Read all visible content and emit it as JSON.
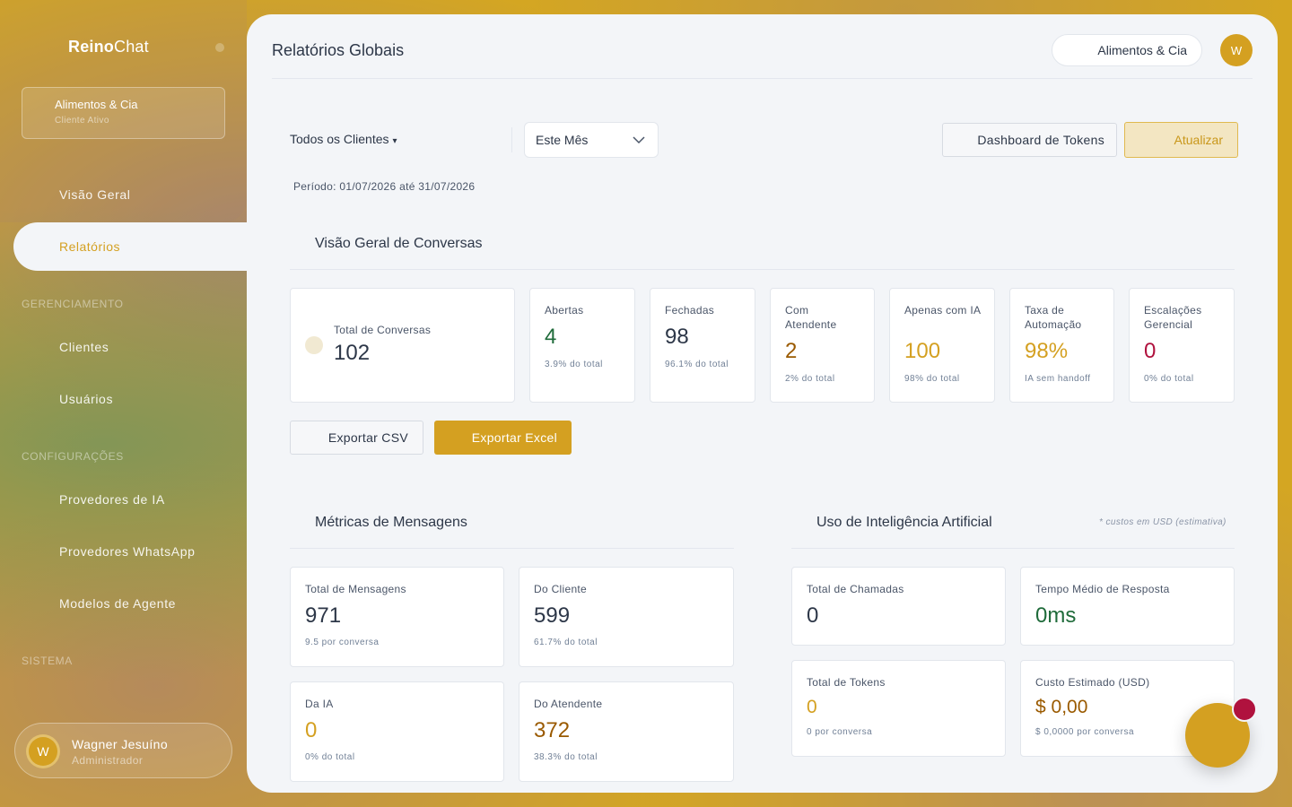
{
  "sidebar": {
    "brand_bold": "Reino",
    "brand_light": "Chat",
    "client_name": "Alimentos & Cia",
    "client_status": "Cliente Ativo",
    "nav": {
      "overview": "Visão Geral",
      "reports": "Relatórios"
    },
    "sections": {
      "management": "GERENCIAMENTO",
      "settings": "CONFIGURAÇÕES",
      "system": "SISTEMA"
    },
    "management_items": {
      "clients": "Clientes",
      "users": "Usuários"
    },
    "settings_items": {
      "ai_providers": "Provedores de IA",
      "whatsapp_providers": "Provedores WhatsApp",
      "agent_models": "Modelos de Agente"
    },
    "user": {
      "initial": "W",
      "name": "Wagner Jesuíno",
      "role": "Administrador"
    }
  },
  "header": {
    "title": "Relatórios Globais",
    "client_selector": "Alimentos & Cia",
    "avatar_initial": "W"
  },
  "filters": {
    "client_filter": "Todos os Clientes",
    "period_select": "Este Mês",
    "tokens_button": "Dashboard de Tokens",
    "update_button": "Atualizar",
    "period_text": "Período: 01/07/2026 até 31/07/2026"
  },
  "conversations": {
    "title": "Visão Geral de Conversas",
    "total": {
      "label": "Total de Conversas",
      "value": "102"
    },
    "cards": [
      {
        "label": "Abertas",
        "value": "4",
        "sub": "3.9% do total"
      },
      {
        "label": "Fechadas",
        "value": "98",
        "sub": "96.1% do total"
      },
      {
        "label": "Com Atendente",
        "value": "2",
        "sub": "2% do total"
      },
      {
        "label": "Apenas com IA",
        "value": "100",
        "sub": "98% do total"
      },
      {
        "label": "Taxa de Automação",
        "value": "98%",
        "sub": "IA sem handoff"
      },
      {
        "label": "Escalações Gerencial",
        "value": "0",
        "sub": "0% do total"
      }
    ],
    "export_csv": "Exportar CSV",
    "export_excel": "Exportar Excel"
  },
  "messages": {
    "title": "Métricas de Mensagens",
    "cards": [
      {
        "label": "Total de Mensagens",
        "value": "971",
        "sub": "9.5 por conversa"
      },
      {
        "label": "Do Cliente",
        "value": "599",
        "sub": "61.7% do total"
      },
      {
        "label": "Da IA",
        "value": "0",
        "sub": "0% do total"
      },
      {
        "label": "Do Atendente",
        "value": "372",
        "sub": "38.3% do total"
      }
    ]
  },
  "ai_usage": {
    "title": "Uso de Inteligência Artificial",
    "note": "* custos em USD (estimativa)",
    "cards": [
      {
        "label": "Total de Chamadas",
        "value": "0"
      },
      {
        "label": "Tempo Médio de Resposta",
        "value": "0ms"
      },
      {
        "label": "Total de Tokens",
        "value": "0",
        "sub": "0 por conversa"
      },
      {
        "label": "Custo Estimado (USD)",
        "value": "$ 0,00",
        "sub": "$ 0,0000 por conversa"
      }
    ]
  },
  "colors": {
    "accent": "#d4a021",
    "green": "#1f6b3a",
    "brown": "#9a5a00",
    "red": "#b0123e",
    "panel": "#f3f5f8"
  }
}
